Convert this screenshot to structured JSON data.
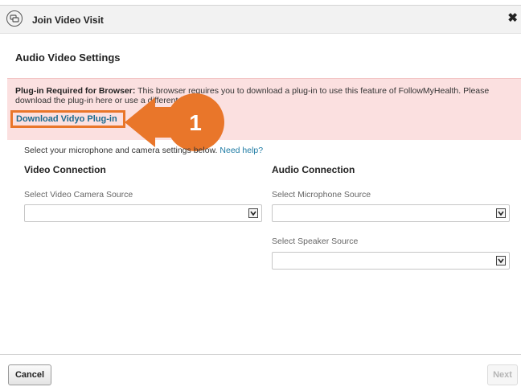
{
  "header": {
    "title": "Join Video Visit",
    "icon": "video-chat-icon",
    "close_glyph": "✖"
  },
  "section_title": "Audio Video Settings",
  "alert": {
    "bold_prefix": "Plug-in Required for Browser:",
    "message": " This browser requires you to download a plug-in to use this feature of FollowMyHealth. Please download the plug-in here or use a different browser.",
    "link_label": "Download Vidyo Plug-in",
    "background": "#fbe0e0"
  },
  "callout": {
    "number": "1",
    "color": "#e9762a"
  },
  "help": {
    "text": "Select your microphone and camera settings below. ",
    "link": "Need help?"
  },
  "video": {
    "heading": "Video Connection",
    "camera_label": "Select Video Camera Source",
    "camera_value": ""
  },
  "audio": {
    "heading": "Audio Connection",
    "mic_label": "Select Microphone Source",
    "mic_value": "",
    "speaker_label": "Select Speaker Source",
    "speaker_value": ""
  },
  "footer": {
    "cancel_label": "Cancel",
    "next_label": "Next"
  },
  "colors": {
    "link": "#1c6b8f",
    "accent": "#e9762a"
  }
}
